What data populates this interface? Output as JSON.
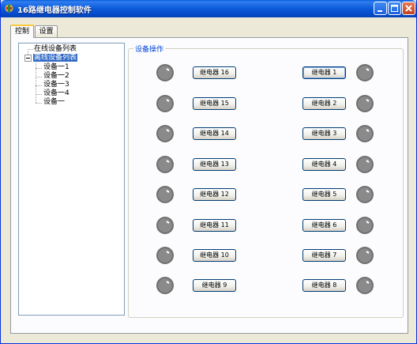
{
  "window": {
    "title": "16路继电器控制软件"
  },
  "tabs": [
    {
      "label": "控制",
      "active": true
    },
    {
      "label": "设置",
      "active": false
    }
  ],
  "tree": {
    "online_root": "在线设备列表",
    "offline_root": "离线设备列表",
    "offline_children": [
      "设备一1",
      "设备一2",
      "设备一3",
      "设备一4",
      "设备一"
    ]
  },
  "group": {
    "title": "设备操作"
  },
  "relays": {
    "left": [
      "继电器 16",
      "继电器 15",
      "继电器 14",
      "继电器 13",
      "继电器 12",
      "继电器 11",
      "继电器 10",
      "继电器 9"
    ],
    "right": [
      "继电器 1",
      "继电器 2",
      "继电器 3",
      "继电器 4",
      "继电器 5",
      "继电器 6",
      "继电器 7",
      "继电器 8"
    ]
  },
  "colors": {
    "title_bar": "#0a5ddc",
    "indicator_off": "#7a7a7a",
    "selection": "#316ac5"
  }
}
